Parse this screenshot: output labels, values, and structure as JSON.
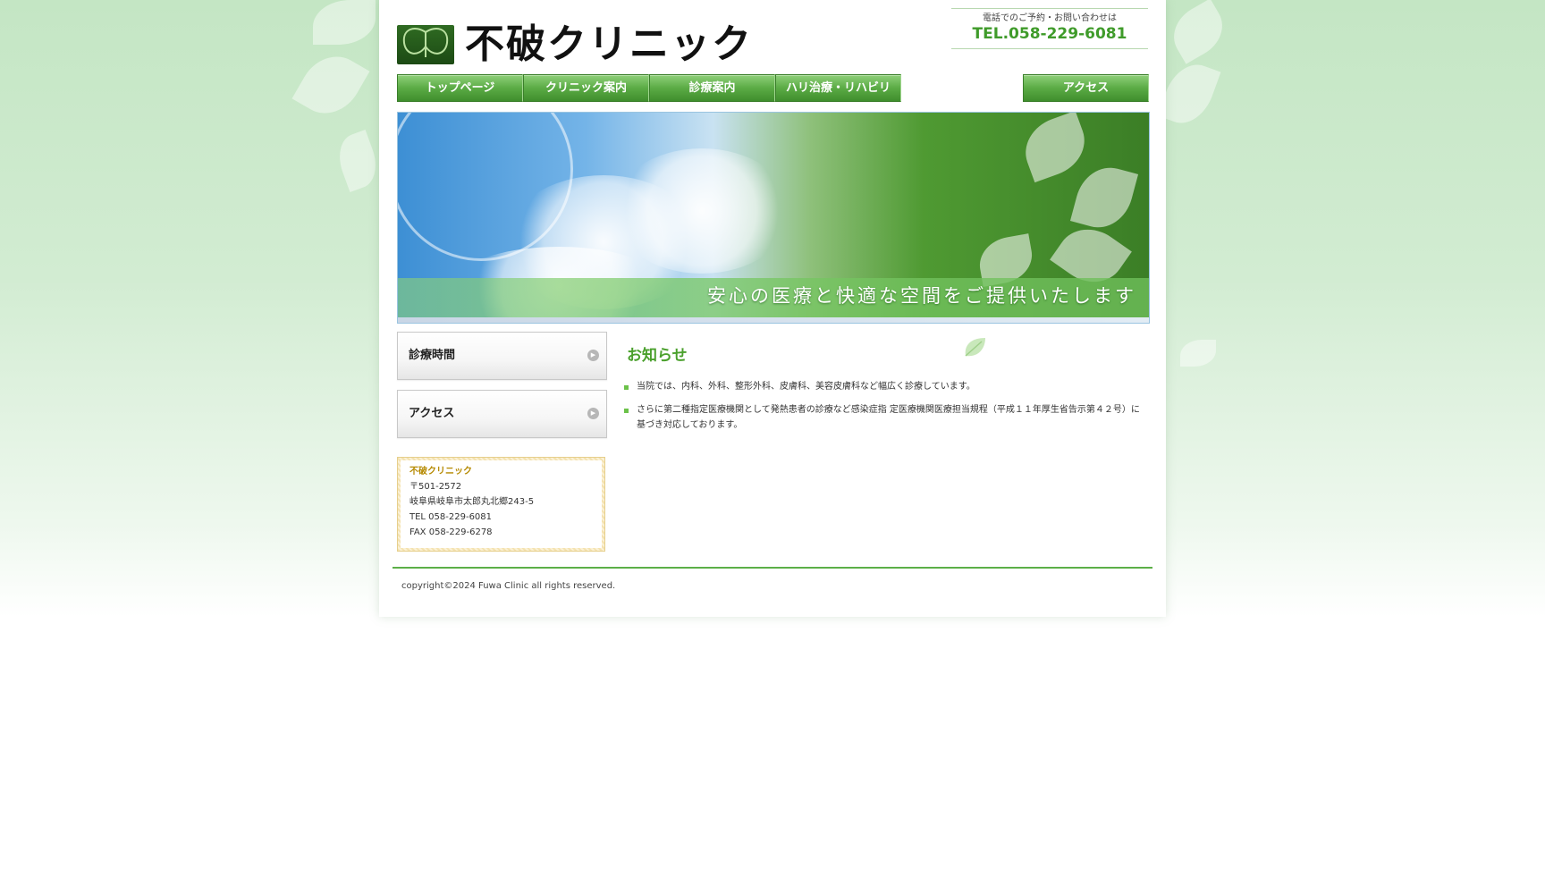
{
  "header": {
    "logo_text": "不破クリニック",
    "contact_note": "電話でのご予約・お問い合わせは",
    "tel": "TEL.058-229-6081"
  },
  "nav": {
    "items": [
      {
        "label": "トップページ"
      },
      {
        "label": "クリニック案内"
      },
      {
        "label": "診療案内"
      },
      {
        "label": "ハリ治療・リハビリ"
      }
    ],
    "access_label": "アクセス"
  },
  "hero": {
    "tagline": "安心の医療と快適な空間をご提供いたします"
  },
  "sidebar": {
    "buttons": [
      {
        "label": "診療時間"
      },
      {
        "label": "アクセス"
      }
    ],
    "info": {
      "name": "不破クリニック",
      "postal": "〒501-2572",
      "address": "岐阜県岐阜市太郎丸北郷243-5",
      "tel": "TEL 058-229-6081",
      "fax": "FAX 058-229-6278"
    }
  },
  "news": {
    "title": "お知らせ",
    "items": [
      {
        "text": "当院では、内科、外科、整形外科、皮膚科、美容皮膚科など幅広く診療しています。"
      },
      {
        "text": "さらに第二種指定医療機関として発熱患者の診療など感染症指 定医療機関医療担当規程（平成１１年厚生省告示第４２号）に基づき対応しております。"
      }
    ]
  },
  "footer": {
    "copyright": "copyright©2024 Fuwa Clinic all rights reserved."
  },
  "colors": {
    "accent_green": "#4aa02c",
    "nav_green": "#5bab45",
    "info_name": "#b58900"
  }
}
